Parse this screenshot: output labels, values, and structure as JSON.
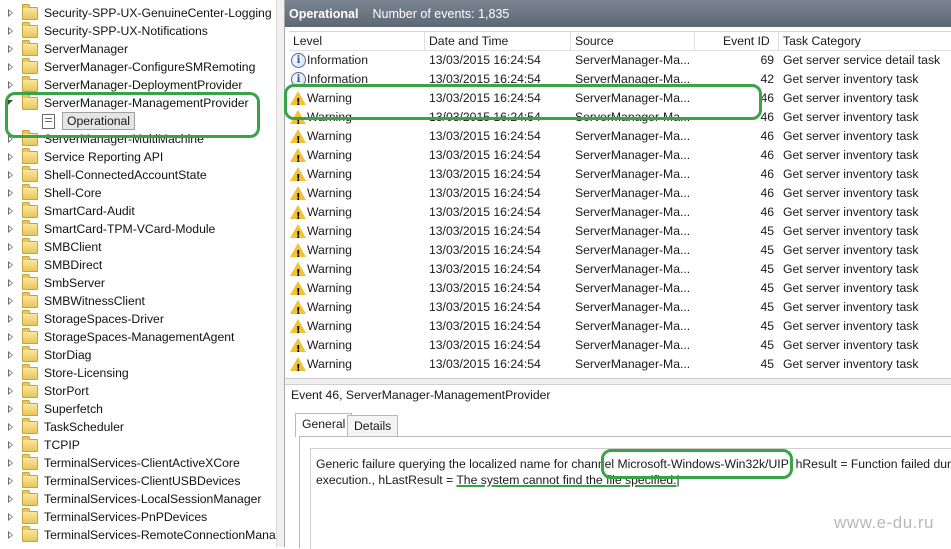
{
  "tree": {
    "items": [
      {
        "label": "Security-SPP-UX-GenuineCenter-Logging",
        "expander": "closed"
      },
      {
        "label": "Security-SPP-UX-Notifications",
        "expander": "closed"
      },
      {
        "label": "ServerManager",
        "expander": "closed"
      },
      {
        "label": "ServerManager-ConfigureSMRemoting",
        "expander": "closed"
      },
      {
        "label": "ServerManager-DeploymentProvider",
        "expander": "closed"
      },
      {
        "label": "ServerManager-ManagementProvider",
        "expander": "open"
      },
      {
        "label": "Operational",
        "expander": "none",
        "selected": true
      },
      {
        "label": "ServerManager-MultiMachine",
        "expander": "closed"
      },
      {
        "label": "Service Reporting API",
        "expander": "closed"
      },
      {
        "label": "Shell-ConnectedAccountState",
        "expander": "closed"
      },
      {
        "label": "Shell-Core",
        "expander": "closed"
      },
      {
        "label": "SmartCard-Audit",
        "expander": "closed"
      },
      {
        "label": "SmartCard-TPM-VCard-Module",
        "expander": "closed"
      },
      {
        "label": "SMBClient",
        "expander": "closed"
      },
      {
        "label": "SMBDirect",
        "expander": "closed"
      },
      {
        "label": "SmbServer",
        "expander": "closed"
      },
      {
        "label": "SMBWitnessClient",
        "expander": "closed"
      },
      {
        "label": "StorageSpaces-Driver",
        "expander": "closed"
      },
      {
        "label": "StorageSpaces-ManagementAgent",
        "expander": "closed"
      },
      {
        "label": "StorDiag",
        "expander": "closed"
      },
      {
        "label": "Store-Licensing",
        "expander": "closed"
      },
      {
        "label": "StorPort",
        "expander": "closed"
      },
      {
        "label": "Superfetch",
        "expander": "closed"
      },
      {
        "label": "TaskScheduler",
        "expander": "closed"
      },
      {
        "label": "TCPIP",
        "expander": "closed"
      },
      {
        "label": "TerminalServices-ClientActiveXCore",
        "expander": "closed"
      },
      {
        "label": "TerminalServices-ClientUSBDevices",
        "expander": "closed"
      },
      {
        "label": "TerminalServices-LocalSessionManager",
        "expander": "closed"
      },
      {
        "label": "TerminalServices-PnPDevices",
        "expander": "closed"
      },
      {
        "label": "TerminalServices-RemoteConnectionManager",
        "expander": "closed"
      }
    ]
  },
  "header": {
    "title": "Operational",
    "count_text": "Number of events: 1,835"
  },
  "grid": {
    "columns": [
      "Level",
      "Date and Time",
      "Source",
      "Event ID",
      "Task Category"
    ],
    "rows": [
      {
        "level": "Information",
        "icon": "info-icon",
        "date": "13/03/2015 16:24:54",
        "source": "ServerManager-Ma...",
        "id": "69",
        "category": "Get server service detail task"
      },
      {
        "level": "Information",
        "icon": "info-icon",
        "date": "13/03/2015 16:24:54",
        "source": "ServerManager-Ma...",
        "id": "42",
        "category": "Get server inventory task"
      },
      {
        "level": "Warning",
        "icon": "warning-icon",
        "date": "13/03/2015 16:24:54",
        "source": "ServerManager-Ma...",
        "id": "46",
        "category": "Get server inventory task"
      },
      {
        "level": "Warning",
        "icon": "warning-icon",
        "date": "13/03/2015 16:24:54",
        "source": "ServerManager-Ma...",
        "id": "46",
        "category": "Get server inventory task"
      },
      {
        "level": "Warning",
        "icon": "warning-icon",
        "date": "13/03/2015 16:24:54",
        "source": "ServerManager-Ma...",
        "id": "46",
        "category": "Get server inventory task"
      },
      {
        "level": "Warning",
        "icon": "warning-icon",
        "date": "13/03/2015 16:24:54",
        "source": "ServerManager-Ma...",
        "id": "46",
        "category": "Get server inventory task"
      },
      {
        "level": "Warning",
        "icon": "warning-icon",
        "date": "13/03/2015 16:24:54",
        "source": "ServerManager-Ma...",
        "id": "46",
        "category": "Get server inventory task"
      },
      {
        "level": "Warning",
        "icon": "warning-icon",
        "date": "13/03/2015 16:24:54",
        "source": "ServerManager-Ma...",
        "id": "46",
        "category": "Get server inventory task"
      },
      {
        "level": "Warning",
        "icon": "warning-icon",
        "date": "13/03/2015 16:24:54",
        "source": "ServerManager-Ma...",
        "id": "46",
        "category": "Get server inventory task"
      },
      {
        "level": "Warning",
        "icon": "warning-icon",
        "date": "13/03/2015 16:24:54",
        "source": "ServerManager-Ma...",
        "id": "45",
        "category": "Get server inventory task"
      },
      {
        "level": "Warning",
        "icon": "warning-icon",
        "date": "13/03/2015 16:24:54",
        "source": "ServerManager-Ma...",
        "id": "45",
        "category": "Get server inventory task"
      },
      {
        "level": "Warning",
        "icon": "warning-icon",
        "date": "13/03/2015 16:24:54",
        "source": "ServerManager-Ma...",
        "id": "45",
        "category": "Get server inventory task"
      },
      {
        "level": "Warning",
        "icon": "warning-icon",
        "date": "13/03/2015 16:24:54",
        "source": "ServerManager-Ma...",
        "id": "45",
        "category": "Get server inventory task"
      },
      {
        "level": "Warning",
        "icon": "warning-icon",
        "date": "13/03/2015 16:24:54",
        "source": "ServerManager-Ma...",
        "id": "45",
        "category": "Get server inventory task"
      },
      {
        "level": "Warning",
        "icon": "warning-icon",
        "date": "13/03/2015 16:24:54",
        "source": "ServerManager-Ma...",
        "id": "45",
        "category": "Get server inventory task"
      },
      {
        "level": "Warning",
        "icon": "warning-icon",
        "date": "13/03/2015 16:24:54",
        "source": "ServerManager-Ma...",
        "id": "45",
        "category": "Get server inventory task"
      },
      {
        "level": "Warning",
        "icon": "warning-icon",
        "date": "13/03/2015 16:24:54",
        "source": "ServerManager-Ma...",
        "id": "45",
        "category": "Get server inventory task"
      }
    ]
  },
  "event": {
    "title": "Event 46, ServerManager-ManagementProvider",
    "tabs": [
      "General",
      "Details"
    ],
    "desc_part1": "Generic failure querying the localized name for channel ",
    "desc_channel": "Microsoft-Windows-Win32k/UIPI",
    "desc_part2": " hResult = Function failed durin",
    "desc_line2_a": "execution., hLastResult = ",
    "desc_line2_b": "The system cannot find the file specified.",
    "desc_line2_c": "|"
  },
  "watermark": "www.e-du.ru",
  "colors": {
    "highlight": "#3aa34a",
    "header_bg": "#6b7581"
  }
}
